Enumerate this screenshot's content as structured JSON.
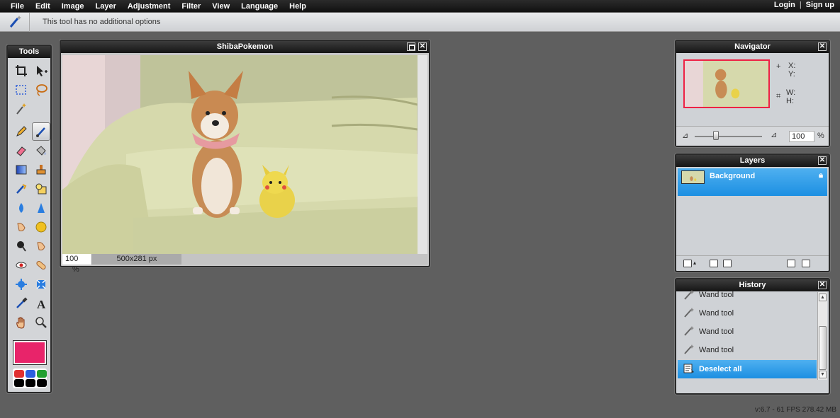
{
  "menu": {
    "items": [
      "File",
      "Edit",
      "Image",
      "Layer",
      "Adjustment",
      "Filter",
      "View",
      "Language",
      "Help"
    ],
    "login": "Login",
    "separator": "|",
    "signup": "Sign up"
  },
  "options_bar": {
    "tool_icon": "wand-icon",
    "text": "This tool has no additional options"
  },
  "tools": {
    "title": "Tools",
    "active_tool": "wand",
    "primary_color": "#e8246a",
    "swatches": [
      "#e03030",
      "#2b5fe0",
      "#22a030",
      "#000000",
      "#000000",
      "#000000"
    ]
  },
  "image_window": {
    "title": "ShibaPokemon",
    "zoom": "100",
    "zoom_unit": "%",
    "size": "500x281 px"
  },
  "navigator": {
    "title": "Navigator",
    "x_label": "X:",
    "y_label": "Y:",
    "w_label": "W:",
    "h_label": "H:",
    "zoom": "100",
    "zoom_unit": "%"
  },
  "layers": {
    "title": "Layers",
    "items": [
      {
        "name": "Background",
        "locked": true,
        "selected": true
      }
    ]
  },
  "history": {
    "title": "History",
    "items": [
      {
        "label": "Wand tool",
        "icon": "wand-icon"
      },
      {
        "label": "Wand tool",
        "icon": "wand-icon"
      },
      {
        "label": "Wand tool",
        "icon": "wand-icon"
      },
      {
        "label": "Wand tool",
        "icon": "wand-icon"
      },
      {
        "label": "Deselect all",
        "icon": "deselect-icon",
        "selected": true
      }
    ]
  },
  "footer": {
    "version": "v:6.7 - 61 FPS 278.42 MB"
  }
}
